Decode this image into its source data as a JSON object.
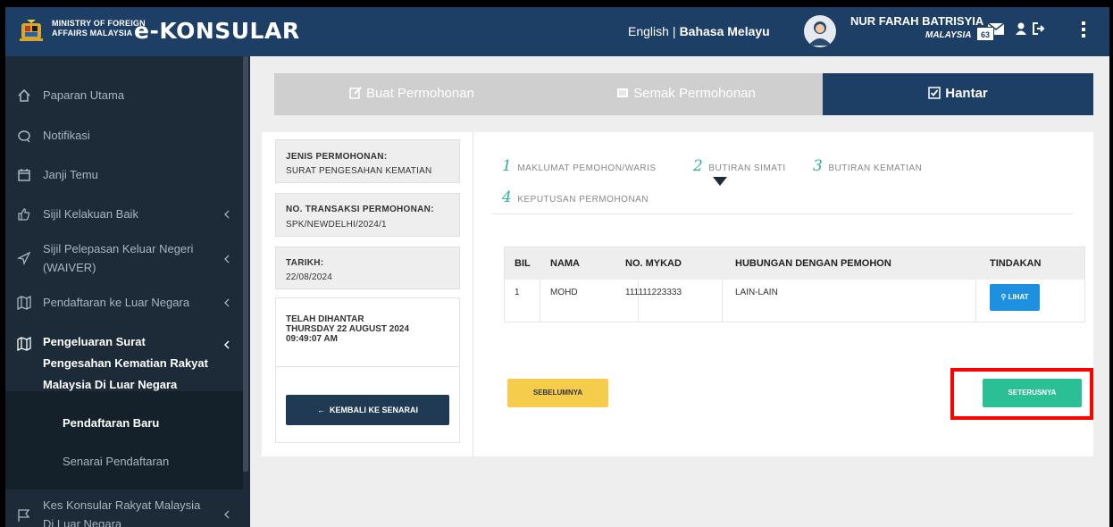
{
  "header": {
    "ministry_line1": "MINISTRY OF FOREIGN",
    "ministry_line2": "AFFAIRS MALAYSIA",
    "logo": "e-KONSULAR",
    "lang_english": "English",
    "lang_separator": "|",
    "lang_malay": "Bahasa Melayu",
    "user_name": "NUR FARAH BATRISYIA",
    "user_country": "MALAYSIA",
    "notification_count": "63",
    "icons": [
      "malaysia-crest",
      "avatar",
      "mail-icon",
      "user-icon",
      "logout-icon",
      "kebab-icon"
    ]
  },
  "sidebar": {
    "items": [
      {
        "label": "Paparan Utama",
        "icon": "home-icon"
      },
      {
        "label": "Notifikasi",
        "icon": "chat-icon"
      },
      {
        "label": "Janji Temu",
        "icon": "calendar-icon"
      },
      {
        "label": "Sijil Kelakuan Baik",
        "icon": "thumbs-up-icon"
      },
      {
        "label": "Sijil Pelepasan Keluar Negeri (WAIVER)",
        "icon": "send-icon"
      },
      {
        "label": "Pendaftaran ke Luar Negara",
        "icon": "map-icon"
      },
      {
        "label": "Pengeluaran Surat Pengesahan Kematian Rakyat Malaysia Di Luar Negara",
        "icon": "map-icon"
      },
      {
        "label": "Kes Konsular Rakyat Malaysia Di Luar Negara",
        "icon": "flag-icon"
      }
    ],
    "submenu": [
      {
        "label": "Pendaftaran Baru"
      },
      {
        "label": "Senarai Pendaftaran"
      }
    ]
  },
  "tabs": [
    {
      "label": "Buat Permohonan",
      "icon": "edit-icon"
    },
    {
      "label": "Semak Permohonan",
      "icon": "list-icon"
    },
    {
      "label": "Hantar",
      "icon": "check-square-icon"
    }
  ],
  "info": {
    "jenis_label": "JENIS PERMOHONAN:",
    "jenis_value": "SURAT PENGESAHAN KEMATIAN",
    "transaksi_label": "NO. TRANSAKSI PERMOHONAN:",
    "transaksi_value": "SPK/NEWDELHI/2024/1",
    "tarikh_label": "TARIKH:",
    "tarikh_value": "22/08/2024",
    "status_line1": "TELAH DIHANTAR",
    "status_line2": "THURSDAY 22 AUGUST 2024",
    "status_line3": "09:49:07 AM",
    "back_button": "KEMBALI KE SENARAI"
  },
  "steps": [
    {
      "num": "1",
      "label": "MAKLUMAT PEMOHON/WARIS"
    },
    {
      "num": "2",
      "label": "BUTIRAN SIMATI"
    },
    {
      "num": "3",
      "label": "BUTIRAN KEMATIAN"
    },
    {
      "num": "4",
      "label": "KEPUTUSAN PERMOHONAN"
    }
  ],
  "table": {
    "headers": [
      "BIL",
      "NAMA",
      "NO. MYKAD",
      "HUBUNGAN DENGAN PEMOHON",
      "TINDAKAN"
    ],
    "rows": [
      {
        "bil": "1",
        "nama": "MOHD",
        "mykad": "111111223333",
        "hubungan": "LAIN-LAIN",
        "action": "LIHAT"
      }
    ]
  },
  "buttons": {
    "prev": "SEBELUMNYA",
    "next": "SETERUSNYA"
  },
  "colors": {
    "header_bg": "#1d3f66",
    "sidebar_bg": "#1c2b37",
    "accent_green": "#2bbf96",
    "accent_blue": "#1e90e0",
    "accent_yellow": "#f5cc4c",
    "highlight_red": "#ff0000"
  }
}
